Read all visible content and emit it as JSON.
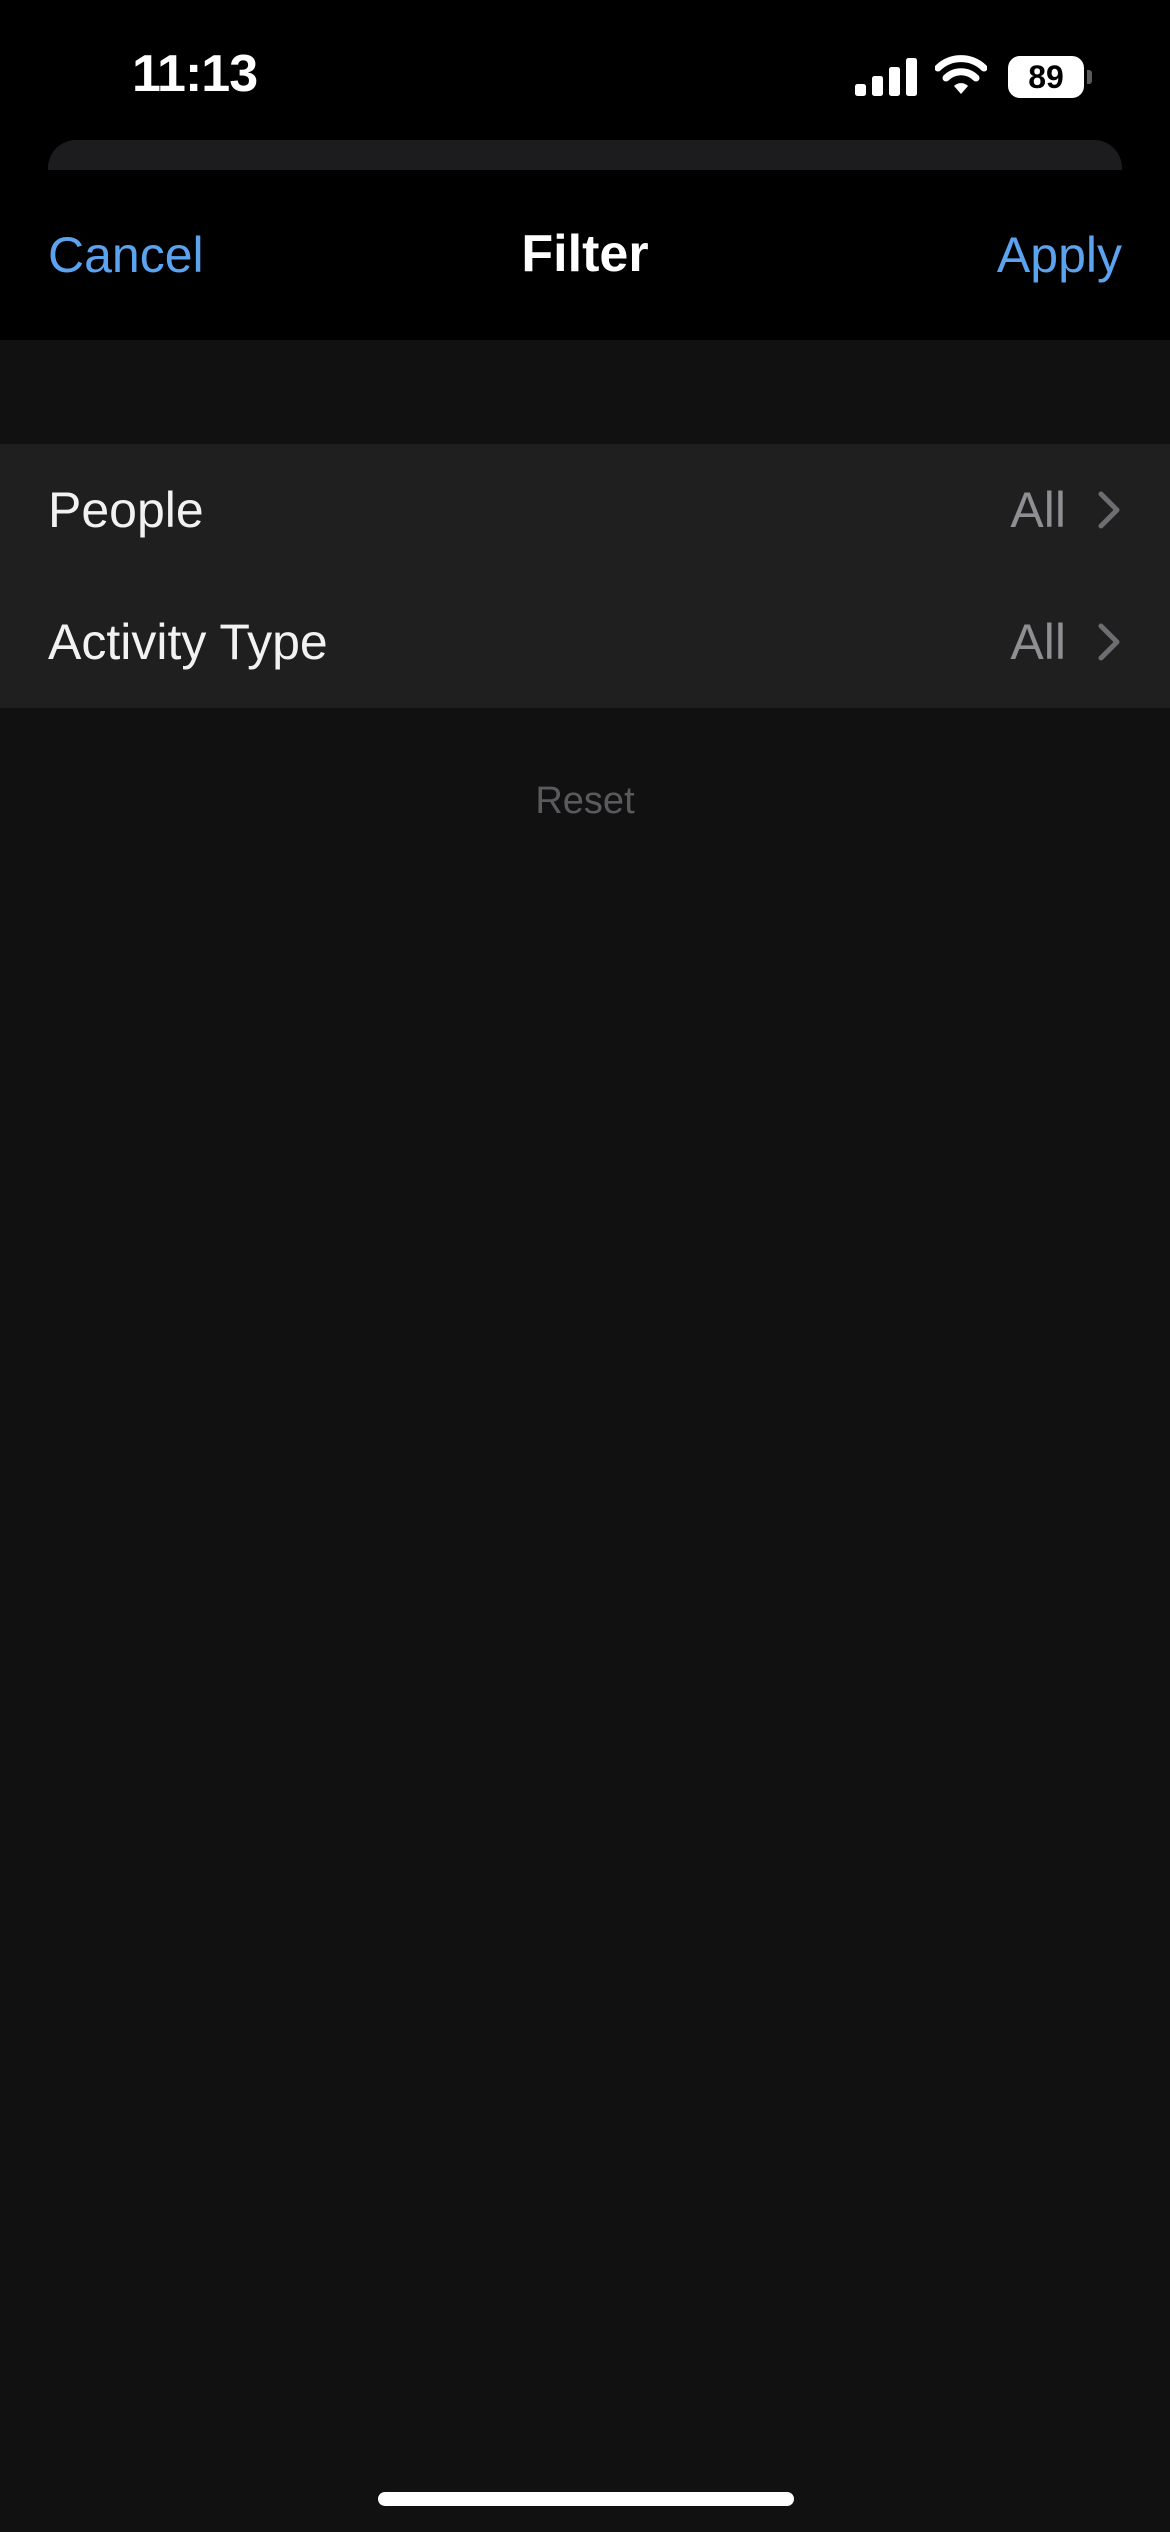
{
  "status_bar": {
    "time": "11:13",
    "battery_level": "89",
    "icons": [
      "signal-icon",
      "wifi-icon",
      "battery-icon"
    ]
  },
  "nav": {
    "cancel_label": "Cancel",
    "title": "Filter",
    "apply_label": "Apply"
  },
  "filters": [
    {
      "label": "People",
      "value": "All",
      "icon": "chevron-right-icon"
    },
    {
      "label": "Activity Type",
      "value": "All",
      "icon": "chevron-right-icon"
    }
  ],
  "reset_label": "Reset",
  "colors": {
    "accent": "#5ba3ef",
    "background": "#111111",
    "group_background": "#1f1f1f",
    "secondary_text": "#8e8e93",
    "reset_text": "#5a5a5e"
  }
}
